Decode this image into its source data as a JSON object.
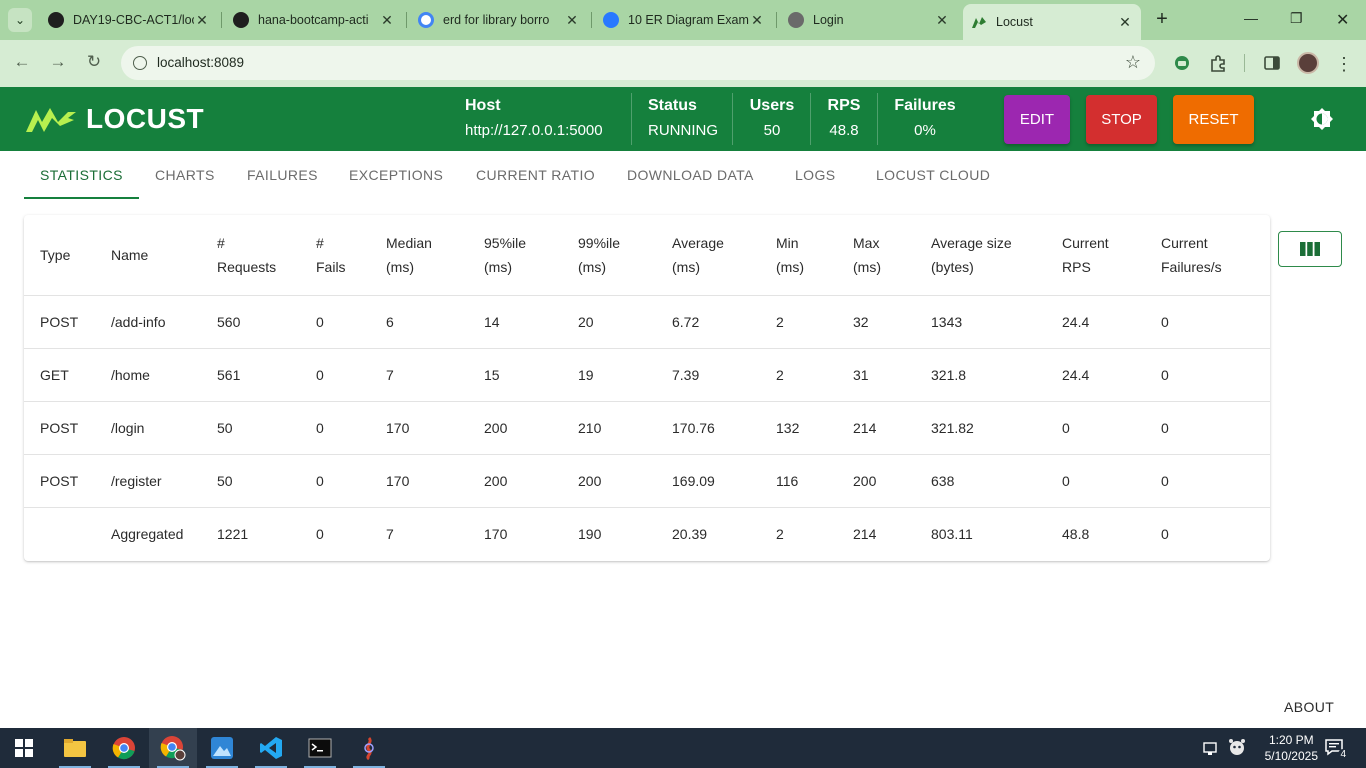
{
  "browser": {
    "tabs": [
      {
        "title": "DAY19-CBC-ACT1/loc",
        "favicon": "github-icon"
      },
      {
        "title": "hana-bootcamp-acti",
        "favicon": "github-icon"
      },
      {
        "title": "erd for library borro",
        "favicon": "google-icon"
      },
      {
        "title": "10 ER Diagram Exam",
        "favicon": "diagram-site-icon"
      },
      {
        "title": "Login",
        "favicon": "globe-icon"
      },
      {
        "title": "Locust",
        "favicon": "locust-icon",
        "active": true
      }
    ],
    "url": "localhost:8089"
  },
  "header": {
    "logo_text": "LOCUST",
    "host_label": "Host",
    "host_value": "http://127.0.0.1:5000",
    "status_label": "Status",
    "status_value": "RUNNING",
    "users_label": "Users",
    "users_value": "50",
    "rps_label": "RPS",
    "rps_value": "48.8",
    "failures_label": "Failures",
    "failures_value": "0%",
    "edit_label": "EDIT",
    "stop_label": "STOP",
    "reset_label": "RESET",
    "colors": {
      "bar": "#15803d",
      "edit": "#9c27b0",
      "stop": "#d32f2f",
      "reset": "#ef6c00"
    }
  },
  "tabs": [
    "STATISTICS",
    "CHARTS",
    "FAILURES",
    "EXCEPTIONS",
    "CURRENT RATIO",
    "DOWNLOAD DATA",
    "LOGS",
    "LOCUST CLOUD"
  ],
  "active_tab": "STATISTICS",
  "table": {
    "columns": [
      [
        "Type"
      ],
      [
        "Name"
      ],
      [
        "#",
        "Requests"
      ],
      [
        "#",
        "Fails"
      ],
      [
        "Median",
        "(ms)"
      ],
      [
        "95%ile",
        "(ms)"
      ],
      [
        "99%ile",
        "(ms)"
      ],
      [
        "Average",
        "(ms)"
      ],
      [
        "Min",
        "(ms)"
      ],
      [
        "Max",
        "(ms)"
      ],
      [
        "Average size",
        "(bytes)"
      ],
      [
        "Current",
        "RPS"
      ],
      [
        "Current",
        "Failures/s"
      ]
    ],
    "rows": [
      [
        "POST",
        "/add-info",
        "560",
        "0",
        "6",
        "14",
        "20",
        "6.72",
        "2",
        "32",
        "1343",
        "24.4",
        "0"
      ],
      [
        "GET",
        "/home",
        "561",
        "0",
        "7",
        "15",
        "19",
        "7.39",
        "2",
        "31",
        "321.8",
        "24.4",
        "0"
      ],
      [
        "POST",
        "/login",
        "50",
        "0",
        "170",
        "200",
        "210",
        "170.76",
        "132",
        "214",
        "321.82",
        "0",
        "0"
      ],
      [
        "POST",
        "/register",
        "50",
        "0",
        "170",
        "200",
        "200",
        "169.09",
        "116",
        "200",
        "638",
        "0",
        "0"
      ],
      [
        "",
        "Aggregated",
        "1221",
        "0",
        "7",
        "170",
        "190",
        "20.39",
        "2",
        "214",
        "803.11",
        "48.8",
        "0"
      ]
    ]
  },
  "footer": {
    "about": "ABOUT"
  },
  "taskbar": {
    "apps": [
      "windows-start-icon",
      "file-explorer-icon",
      "chrome-icon",
      "chrome-profile-icon",
      "photos-icon",
      "vscode-icon",
      "terminal-icon",
      "jmeter-icon"
    ],
    "time": "1:20 PM",
    "date": "5/10/2025",
    "notifications": "4"
  }
}
